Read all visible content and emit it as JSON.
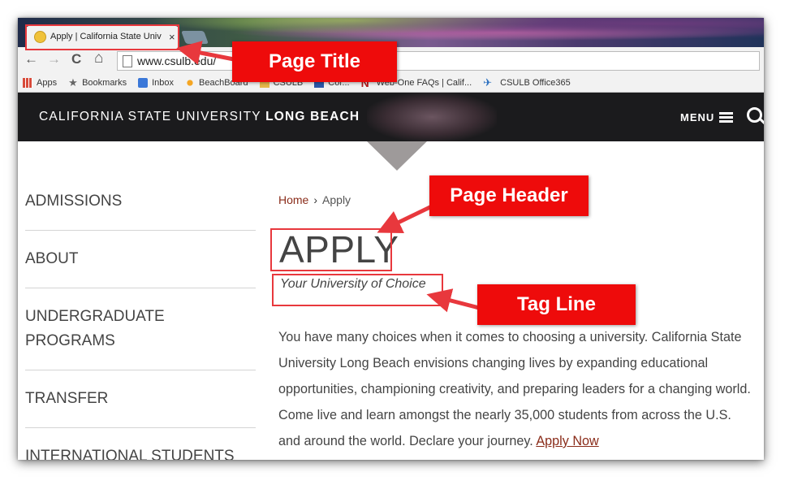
{
  "browser": {
    "tab_title": "Apply | California State Univ",
    "tab_close": "×",
    "address": "www.csulb.edu/",
    "nav": {
      "back": "←",
      "forward": "→",
      "reload": "C",
      "home": "⌂"
    },
    "bookmarks": [
      {
        "label": "Apps",
        "icon": "apps-grid-icon"
      },
      {
        "label": "Bookmarks",
        "icon": "star-icon"
      },
      {
        "label": "Inbox",
        "icon": "inbox-icon"
      },
      {
        "label": "BeachBoard",
        "icon": "sun-icon"
      },
      {
        "label": "CSULB",
        "icon": "folder-icon"
      },
      {
        "label": "Cor...",
        "icon": "doc-icon"
      },
      {
        "label": "Web-One FAQs | Calif...",
        "icon": "n-logo-icon"
      },
      {
        "label": "CSULB Office365",
        "icon": "plane-icon"
      }
    ]
  },
  "site": {
    "brand_light": "CALIFORNIA STATE UNIVERSITY ",
    "brand_bold": "LONG BEACH",
    "menu_label": "MENU",
    "sidebar": [
      {
        "label": "ADMISSIONS"
      },
      {
        "label": "ABOUT"
      },
      {
        "label": "UNDERGRADUATE PROGRAMS"
      },
      {
        "label": "TRANSFER"
      },
      {
        "label": "INTERNATIONAL STUDENTS"
      }
    ],
    "breadcrumb": {
      "home": "Home",
      "sep": "›",
      "current": "Apply"
    },
    "title": "APPLY",
    "tagline": "Your University of Choice",
    "body": " You have many choices when it comes to choosing a university. California State University Long Beach envisions changing lives by expanding educational opportunities, championing creativity, and preparing leaders for a changing world. Come live and learn amongst the nearly 35,000 students from across the U.S. and around the world. Declare your journey. ",
    "apply_link": "Apply Now"
  },
  "annotations": {
    "page_title": "Page Title",
    "page_header": "Page Header",
    "tag_line": "Tag Line",
    "color": "#ee0b0b"
  }
}
